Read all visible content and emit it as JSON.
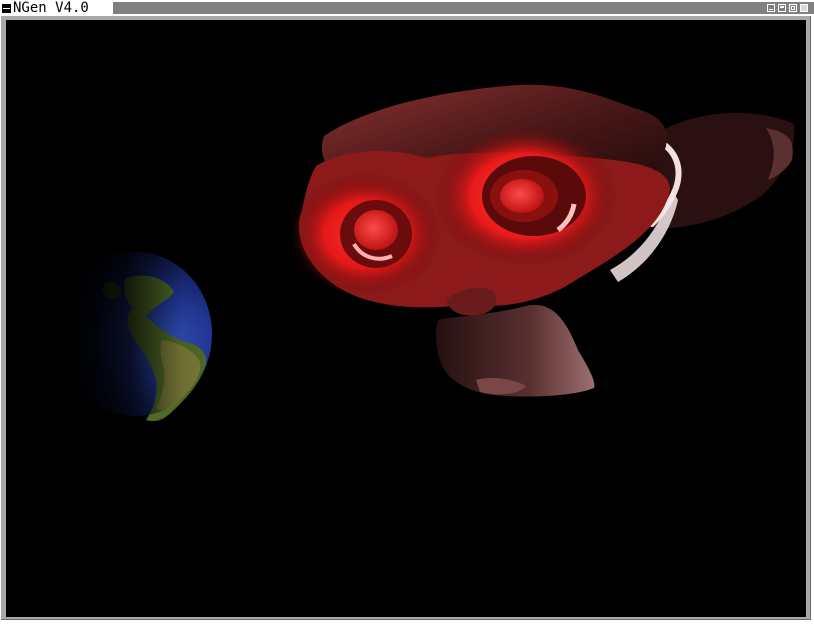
{
  "window": {
    "title": "NGen V4.0",
    "controls": [
      "minimize",
      "shade",
      "maximize",
      "close"
    ]
  },
  "scene": {
    "background": "#000000",
    "objects": [
      "globe",
      "monkey-head"
    ],
    "accent_color": "#ff2020"
  }
}
